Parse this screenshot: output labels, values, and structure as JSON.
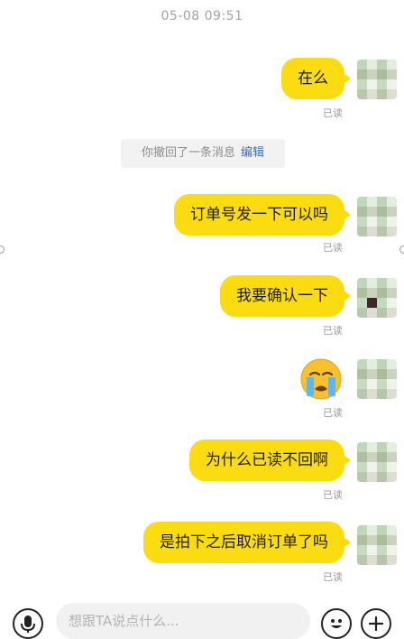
{
  "header": {
    "timestamp": "05-08 09:51"
  },
  "messages": [
    {
      "type": "text",
      "text": "在么",
      "status": "已读"
    },
    {
      "type": "text",
      "text": "订单号发一下可以吗",
      "status": "已读"
    },
    {
      "type": "text",
      "text": "我要确认一下",
      "status": "已读"
    },
    {
      "type": "emoji",
      "emoji": "crying-face",
      "status": "已读"
    },
    {
      "type": "text",
      "text": "为什么已读不回啊",
      "status": "已读"
    },
    {
      "type": "text",
      "text": "是拍下之后取消订单了吗",
      "status": "已读"
    }
  ],
  "recall_notice": {
    "text": "你撤回了一条消息",
    "edit_label": "编辑"
  },
  "input_bar": {
    "placeholder": "想跟TA说点什么...",
    "icons": [
      "microphone-icon",
      "emoji-icon",
      "plus-icon"
    ]
  },
  "colors": {
    "bubble": "#fadc10",
    "edit_link": "#3e6fb1"
  }
}
